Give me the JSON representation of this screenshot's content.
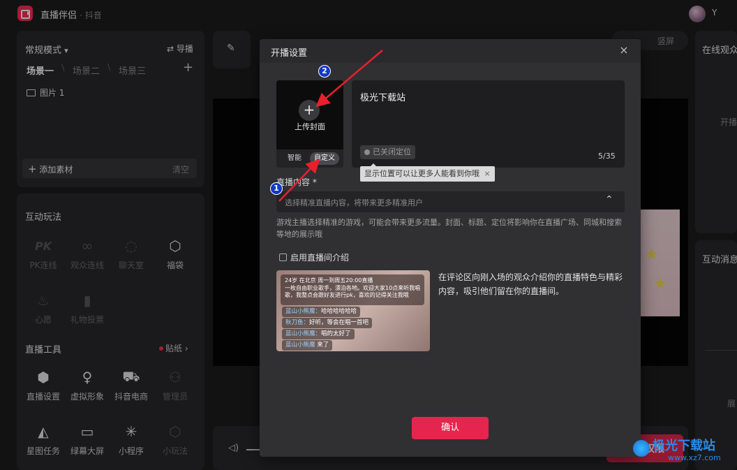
{
  "app": {
    "title": "直播伴侣",
    "subtitle": "· 抖音",
    "user_initial": "Y"
  },
  "scene_panel": {
    "mode": "常规模式",
    "mode_caret": "▾",
    "guide": "导播",
    "scenes": [
      "场景一",
      "场景二",
      "场景三"
    ],
    "add_scene": "+",
    "source_item": "图片 1",
    "add_source": "添加素材",
    "clear": "清空"
  },
  "interaction": {
    "title": "互动玩法",
    "items": [
      {
        "label": "PK连线",
        "icon": "pk-icon",
        "glyph": "PK",
        "enabled": false
      },
      {
        "label": "观众连线",
        "icon": "link-icon",
        "glyph": "∞",
        "enabled": false
      },
      {
        "label": "聊天室",
        "icon": "chat-room-icon",
        "glyph": "◌",
        "enabled": false
      },
      {
        "label": "福袋",
        "icon": "lucky-bag-icon",
        "glyph": "⬡",
        "enabled": true
      },
      {
        "label": "心愿",
        "icon": "wish-icon",
        "glyph": "♨",
        "enabled": false
      },
      {
        "label": "礼物投票",
        "icon": "gift-vote-icon",
        "glyph": "▮",
        "enabled": false
      }
    ]
  },
  "live_tools": {
    "title": "直播工具",
    "sticker": "贴纸",
    "items": [
      {
        "label": "直播设置",
        "icon": "live-settings-icon",
        "glyph": "⬢",
        "enabled": true
      },
      {
        "label": "虚拟形象",
        "icon": "avatar-icon",
        "glyph": "♀",
        "enabled": true
      },
      {
        "label": "抖音电商",
        "icon": "cart-icon",
        "glyph": "⛟",
        "enabled": true
      },
      {
        "label": "管理员",
        "icon": "admin-icon",
        "glyph": "⚇",
        "enabled": false
      },
      {
        "label": "星图任务",
        "icon": "star-task-icon",
        "glyph": "◭",
        "enabled": true
      },
      {
        "label": "绿幕大屏",
        "icon": "green-screen-icon",
        "glyph": "▭",
        "enabled": true
      },
      {
        "label": "小程序",
        "icon": "mini-program-icon",
        "glyph": "✳",
        "enabled": true
      },
      {
        "label": "小玩法",
        "icon": "mini-game-icon",
        "glyph": "⬡",
        "enabled": false
      }
    ]
  },
  "right_panels": {
    "online": "在线观众",
    "online_sub": "开播",
    "messages": "互动消息",
    "messages_sub": "展"
  },
  "preview": {
    "orientation": "竖屏",
    "live_button": "开播权限"
  },
  "modal": {
    "title": "开播设置",
    "close": "×",
    "cover_plus": "+",
    "cover_label": "上传封面",
    "cover_tabs": [
      "智能",
      "自定义"
    ],
    "live_title": "极光下载站",
    "location": "已关闭定位",
    "counter": "5/35",
    "tooltip": "显示位置可以让更多人能看到你哦",
    "tooltip_close": "×",
    "content_label": "直播内容 *",
    "content_placeholder": "选择精准直播内容，将带来更多精准用户",
    "content_caret": "⌃",
    "content_desc": "游戏主播选择精准的游戏，可能会带来更多流量。封面、标题、定位将影响你在直播广场、同城和搜索等地的展示哦",
    "intro_check": "启用直播间介绍",
    "intro_example": {
      "header": "24岁  在北京  周一到周五20:00直播",
      "body": "一枚自由职业歌手，漂泊各地。欢迎大家10点来听我唱歌，我整点会跟好友进行pk，喜欢的记得关注我哦",
      "chats": [
        {
          "name": "蓝山小熊魔：",
          "text": "哈哈哈哈哈哈"
        },
        {
          "name": "秋刀鱼：",
          "text": "好听，等会在唱一首吧"
        },
        {
          "name": "蓝山小熊魔：",
          "text": "唱的太好了"
        },
        {
          "name": "蓝山小熊魔",
          "text": "来了"
        }
      ]
    },
    "intro_desc": "在评论区向刚入场的观众介绍你的直播特色与精彩内容，吸引他们留在你的直播间。",
    "confirm": "确认"
  },
  "annotations": {
    "badge1": "1",
    "badge2": "2",
    "arrow_color": "#e8202c"
  },
  "watermark": {
    "cn": "极光下载站",
    "url": "www.xz7.com"
  },
  "colors": {
    "accent": "#e5254d",
    "bg": "#1c1c1e",
    "panel": "#29292c",
    "modal": "#303033"
  }
}
